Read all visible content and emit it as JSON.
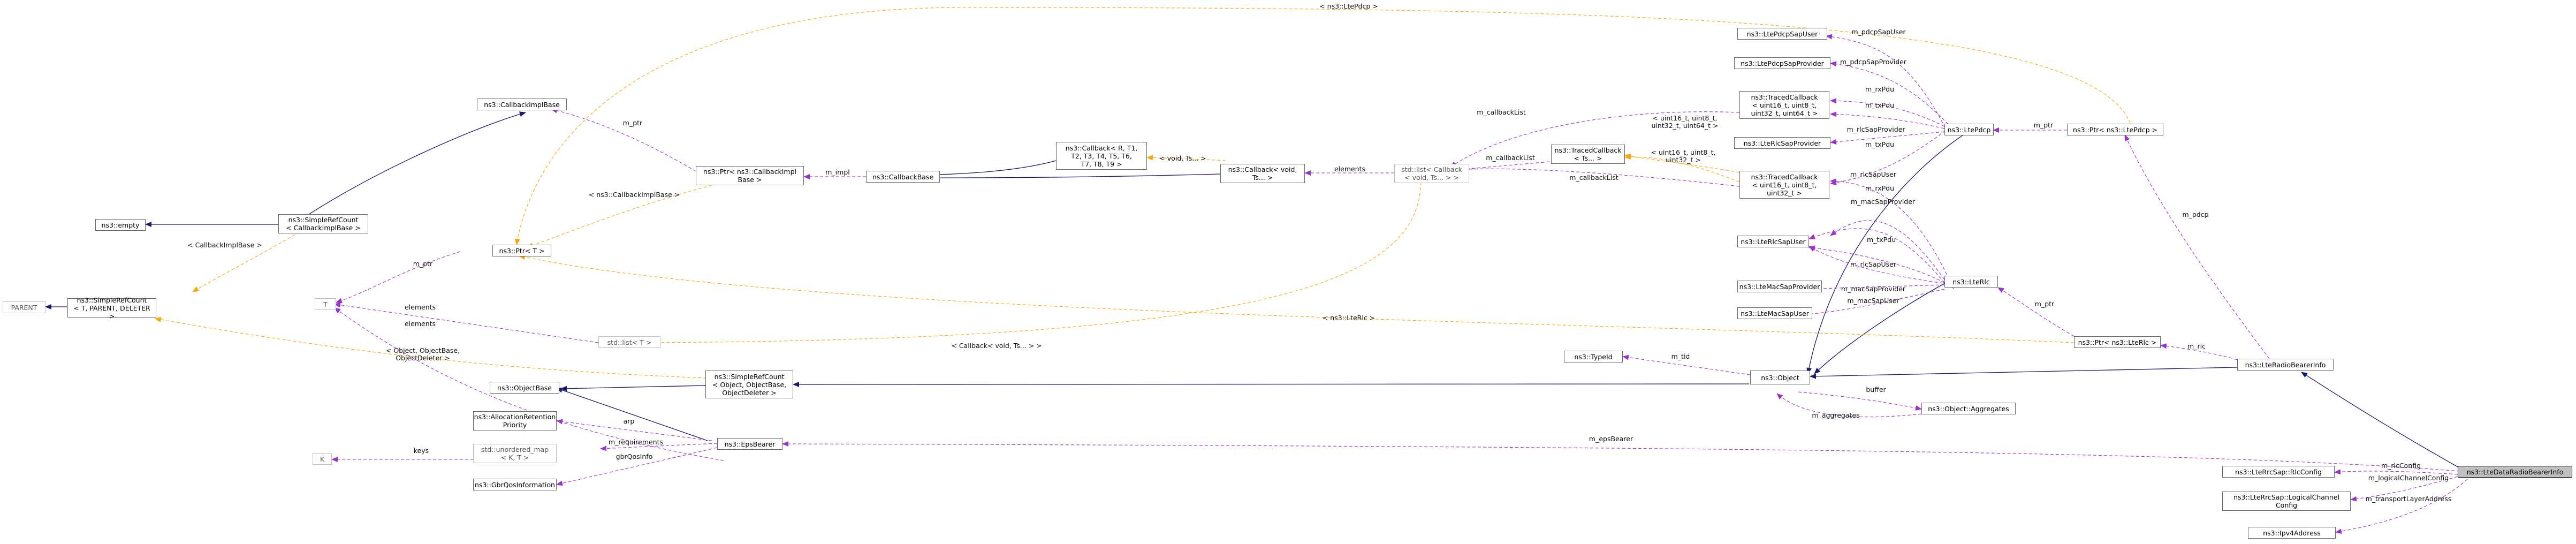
{
  "diagram": {
    "nodes": {
      "ns3_empty": "ns3::empty",
      "parent": "PARENT",
      "simplerefcount_tpd": "ns3::SimpleRefCount\n< T, PARENT, DELETER >",
      "simplerefcount_cbi": "ns3::SimpleRefCount\n< CallbackImplBase >",
      "callbackimplbase": "ns3::CallbackImplBase",
      "ptr_t": "ns3::Ptr< T >",
      "t": "T",
      "ptr_cbi": "ns3::Ptr< ns3::CallbackImpl\nBase >",
      "callbackbase": "ns3::CallbackBase",
      "callback_r": "ns3::Callback< R, T1,\nT2, T3, T4, T5, T6,\nT7, T8, T9 >",
      "callback_void": "ns3::Callback< void,\nTs... >",
      "stdlist_cb": "std::list< Callback\n< void, Ts... > >",
      "stdlist_t": "std::list< T >",
      "objectbase": "ns3::ObjectBase",
      "simplerefcount_obj": "ns3::SimpleRefCount\n< Object, ObjectBase,\nObjectDeleter >",
      "allocretention": "ns3::AllocationRetention\nPriority",
      "unordered_map": "std::unordered_map\n< K, T >",
      "k": "K",
      "gbrqos": "ns3::GbrQosInformation",
      "epsbearer": "ns3::EpsBearer",
      "typeid": "ns3::TypeId",
      "object": "ns3::Object",
      "aggregates": "ns3::Object::Aggregates",
      "tracedcb_u8u8u32": "ns3::TracedCallback\n< uint16_t, uint8_t,\nuint32_t >",
      "tracedcb_ts": "ns3::TracedCallback\n< Ts... >",
      "tracedcb_u64": "ns3::TracedCallback\n< uint16_t, uint8_t,\nuint32_t, uint64_t >",
      "pdcpsapuser": "ns3::LtePdcpSapUser",
      "pdcpsapprovider": "ns3::LtePdcpSapProvider",
      "rlcsapprovider": "ns3::LteRlcSapProvider",
      "rlcsapuser": "ns3::LteRlcSapUser",
      "macsapprovider": "ns3::LteMacSapProvider",
      "macsapuser": "ns3::LteMacSapUser",
      "ltepdcp": "ns3::LtePdcp",
      "lterlc": "ns3::LteRlc",
      "ptr_pdcp": "ns3::Ptr< ns3::LtePdcp >",
      "ptr_rlc": "ns3::Ptr< ns3::LteRlc >",
      "radiobearerinfo": "ns3::LteRadioBearerInfo",
      "dataradiobearerinfo": "ns3::LteDataRadioBearerInfo",
      "rrcsap_rlcconfig": "ns3::LteRrcSap::RlcConfig",
      "rrcsap_lcconfig": "ns3::LteRrcSap::LogicalChannel\nConfig",
      "ipv4address": "ns3::Ipv4Address"
    },
    "edge_labels": {
      "cbi_base": "< CallbackImplBase >",
      "m_ptr_1": "m_ptr",
      "m_ptr_2": "m_ptr",
      "cbi_ptr": "< ns3::CallbackImplBase >",
      "m_impl": "m_impl",
      "void_ts": "< void, Ts... >",
      "elements_1": "elements",
      "elements_2": "elements",
      "elements_3": "elements",
      "cb_void_ts": "< Callback< void, Ts... > >",
      "obj_base_del": "< Object, ObjectBase,\nObjectDeleter >",
      "ltepdcp_tpl": "< ns3::LtePdcp >",
      "lterlc_tpl": "< ns3::LteRlc >",
      "m_callbacklist_1": "m_callbackList",
      "m_callbacklist_2": "m_callbackList",
      "m_callbacklist_3": "m_callbackList",
      "u64_tpl": "< uint16_t, uint8_t,\nuint32_t, uint64_t >",
      "u32_tpl": "< uint16_t, uint8_t,\nuint32_t >",
      "m_pdcpsapuser": "m_pdcpSapUser",
      "m_pdcpsapprovider": "m_pdcpSapProvider",
      "m_rxpdu_1": "m_rxPdu",
      "m_txpdu_1": "m_txPdu",
      "m_rlcsapprovider": "m_rlcSapProvider",
      "m_txpdu_2": "m_txPdu",
      "m_rlcsapuser_1": "m_rlcSapUser",
      "m_rxpdu_2": "m_rxPdu",
      "m_macsapprovider_1": "m_macSapProvider",
      "m_txpdu_3": "m_txPdu",
      "m_rlcsapuser_2": "m_rlcSapUser",
      "m_macsapprovider_2": "m_macSapProvider",
      "m_macsapuser": "m_macSapUser",
      "m_ptr_pdcp": "m_ptr",
      "m_ptr_rlc": "m_ptr",
      "m_pdcp": "m_pdcp",
      "m_rlc": "m_rlc",
      "m_tid": "m_tid",
      "buffer": "buffer",
      "m_aggregates": "m_aggregates",
      "m_epsbearer": "m_epsBearer",
      "arp": "arp",
      "m_requirements": "m_requirements",
      "gbrqosinfo": "gbrQosInfo",
      "keys": "keys",
      "m_rlcconfig": "m_rlcConfig",
      "m_lcconfig": "m_logicalChannelConfig",
      "m_transportlayeraddress": "m_transportLayerAddress"
    },
    "colors": {
      "inheritance": "#191970",
      "usage": "#9a32cd",
      "template": "#ffa500",
      "node_border": "#666666",
      "focus_fill": "#bfbfbf"
    }
  }
}
